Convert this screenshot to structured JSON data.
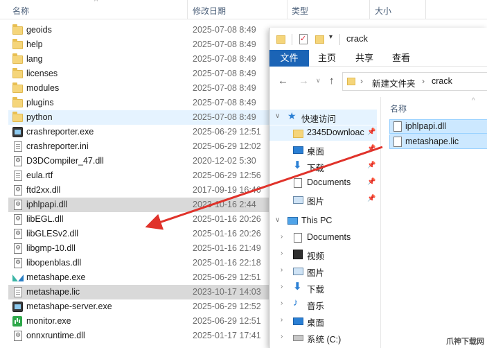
{
  "background_explorer": {
    "columns": {
      "name": "名称",
      "date": "修改日期",
      "type": "类型",
      "size": "大小"
    },
    "files": [
      {
        "name": "geoids",
        "date": "2025-07-08 8:49",
        "icon": "folder-icon"
      },
      {
        "name": "help",
        "date": "2025-07-08 8:49",
        "icon": "folder-icon"
      },
      {
        "name": "lang",
        "date": "2025-07-08 8:49",
        "icon": "folder-icon"
      },
      {
        "name": "licenses",
        "date": "2025-07-08 8:49",
        "icon": "folder-icon"
      },
      {
        "name": "modules",
        "date": "2025-07-08 8:49",
        "icon": "folder-icon"
      },
      {
        "name": "plugins",
        "date": "2025-07-08 8:49",
        "icon": "folder-icon"
      },
      {
        "name": "python",
        "date": "2025-07-08 8:49",
        "icon": "folder-icon"
      },
      {
        "name": "crashreporter.exe",
        "date": "2025-06-29 12:51",
        "icon": "exe-icon"
      },
      {
        "name": "crashreporter.ini",
        "date": "2025-06-29 12:02",
        "icon": "ini-file-icon"
      },
      {
        "name": "D3DCompiler_47.dll",
        "date": "2020-12-02 5:30",
        "icon": "dll-icon"
      },
      {
        "name": "eula.rtf",
        "date": "2025-06-29 12:56",
        "icon": "document-icon"
      },
      {
        "name": "ftd2xx.dll",
        "date": "2017-09-19 16:46",
        "icon": "dll-icon"
      },
      {
        "name": "iphlpapi.dll",
        "date": "2023-10-16 2:44",
        "icon": "dll-icon"
      },
      {
        "name": "libEGL.dll",
        "date": "2025-01-16 20:26",
        "icon": "dll-icon"
      },
      {
        "name": "libGLESv2.dll",
        "date": "2025-01-16 20:26",
        "icon": "dll-icon"
      },
      {
        "name": "libgmp-10.dll",
        "date": "2025-01-16 21:49",
        "icon": "dll-icon"
      },
      {
        "name": "libopenblas.dll",
        "date": "2025-01-16 22:18",
        "icon": "dll-icon"
      },
      {
        "name": "metashape.exe",
        "date": "2025-06-29 12:51",
        "icon": "metashape-icon"
      },
      {
        "name": "metashape.lic",
        "date": "2023-10-17 14:03",
        "icon": "document-icon"
      },
      {
        "name": "metashape-server.exe",
        "date": "2025-06-29 12:52",
        "icon": "exe-icon"
      },
      {
        "name": "monitor.exe",
        "date": "2025-06-29 12:51",
        "icon": "monitor-exe-icon"
      },
      {
        "name": "onnxruntime.dll",
        "date": "2025-01-17 17:41",
        "icon": "dll-icon"
      }
    ]
  },
  "foreground_window": {
    "title": "crack",
    "ribbon_tabs": [
      "文件",
      "主页",
      "共享",
      "查看"
    ],
    "breadcrumb": [
      "新建文件夹",
      "crack"
    ],
    "nav_pane": {
      "quick_access": "快速访问",
      "pinned": [
        "2345Downloac",
        "桌面",
        "下载",
        "Documents",
        "图片"
      ],
      "this_pc": "This PC",
      "pc_items": [
        "Documents",
        "视频",
        "图片",
        "下载",
        "音乐",
        "桌面",
        "系统 (C:)"
      ]
    },
    "content": {
      "column_name": "名称",
      "files": [
        "iphlpapi.dll",
        "metashape.lic"
      ]
    }
  },
  "watermark": "爪神下载网",
  "colors": {
    "accent": "#1b64b6",
    "selection": "#cce8ff",
    "arrow": "#e0322a"
  }
}
